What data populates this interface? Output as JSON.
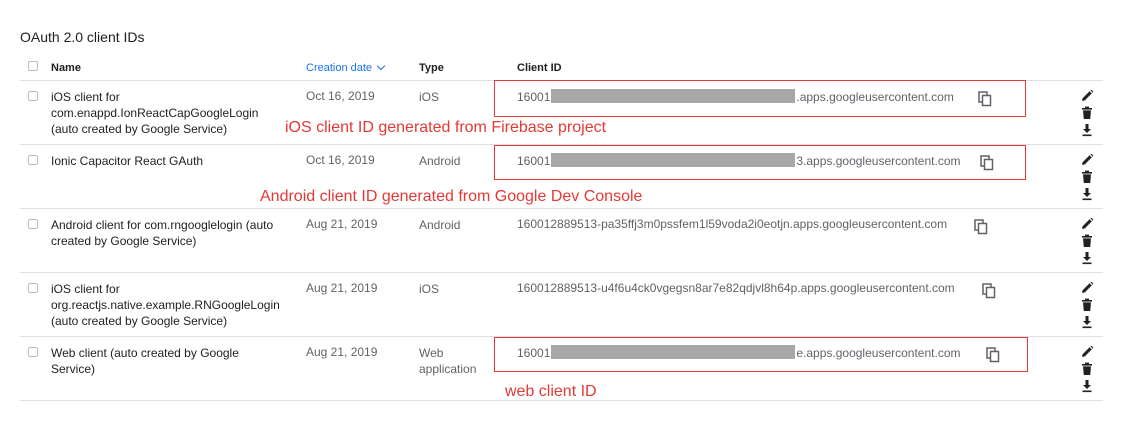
{
  "section_title": "OAuth 2.0 client IDs",
  "columns": {
    "name": "Name",
    "creation_date": "Creation date",
    "type": "Type",
    "client_id": "Client ID"
  },
  "rows": [
    {
      "name_lines": [
        "iOS client for",
        "com.enappd.IonReactCapGoogleLogin",
        "(auto created by Google Service)"
      ],
      "date": "Oct 16, 2019",
      "type_lines": [
        "iOS"
      ],
      "client_id_prefix": "16001",
      "client_id_suffix": ".apps.googleusercontent.com",
      "redacted": true
    },
    {
      "name_lines": [
        "Ionic Capacitor React GAuth"
      ],
      "date": "Oct 16, 2019",
      "type_lines": [
        "Android"
      ],
      "client_id_prefix": "16001",
      "client_id_suffix": "3.apps.googleusercontent.com",
      "redacted": true
    },
    {
      "name_lines": [
        "Android client for com.rngooglelogin (auto",
        "created by Google Service)"
      ],
      "date": "Aug 21, 2019",
      "type_lines": [
        "Android"
      ],
      "client_id_prefix": "160012889513-pa35ffj3m0pssfem1l59voda2i0eotjn.apps.googleusercontent.com",
      "client_id_suffix": "",
      "redacted": false
    },
    {
      "name_lines": [
        "iOS client for",
        "org.reactjs.native.example.RNGoogleLogin",
        "(auto created by Google Service)"
      ],
      "date": "Aug 21, 2019",
      "type_lines": [
        "iOS"
      ],
      "client_id_prefix": "160012889513-u4f6u4ck0vgegsn8ar7e82qdjvl8h64p.apps.googleusercontent.com",
      "client_id_suffix": "",
      "redacted": false
    },
    {
      "name_lines": [
        "Web client (auto created by Google",
        "Service)"
      ],
      "date": "Aug 21, 2019",
      "type_lines": [
        "Web",
        "application"
      ],
      "client_id_prefix": "16001",
      "client_id_suffix": "e.apps.googleusercontent.com",
      "redacted": true
    }
  ],
  "annotations": {
    "ios": "iOS client ID generated from Firebase project",
    "android": "Android client ID generated from Google Dev Console",
    "web": "web client ID"
  },
  "colors": {
    "accent": "#1a73e8",
    "annotation": "#e53935",
    "redaction": "#a7a7a7"
  }
}
